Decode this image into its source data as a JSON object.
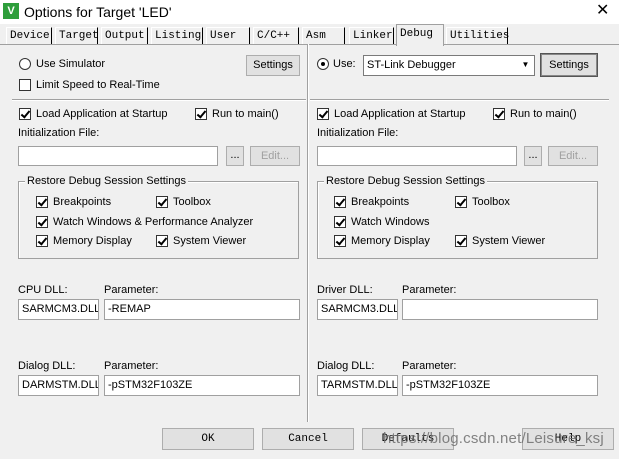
{
  "window": {
    "title": "Options for Target 'LED'",
    "icon": "V",
    "close": "✕"
  },
  "tabs": [
    "Device",
    "Target",
    "Output",
    "Listing",
    "User",
    "C/C++",
    "Asm",
    "Linker",
    "Debug",
    "Utilities"
  ],
  "active_tab": "Debug",
  "left": {
    "use_simulator": "Use Simulator",
    "settings": "Settings",
    "limit_speed": "Limit Speed to Real-Time",
    "load_app": "Load Application at Startup",
    "run_to_main": "Run to main()",
    "init_file_label": "Initialization File:",
    "init_file_value": "",
    "browse": "...",
    "edit": "Edit...",
    "restore_title": "Restore Debug Session Settings",
    "breakpoints": "Breakpoints",
    "toolbox": "Toolbox",
    "watch_windows": "Watch Windows & Performance Analyzer",
    "memory_display": "Memory Display",
    "system_viewer": "System Viewer",
    "cpu_dll_label": "CPU DLL:",
    "cpu_param_label": "Parameter:",
    "cpu_dll": "SARMCM3.DLL",
    "cpu_param": "-REMAP",
    "dialog_dll_label": "Dialog DLL:",
    "dialog_param_label": "Parameter:",
    "dialog_dll": "DARMSTM.DLL",
    "dialog_param": "-pSTM32F103ZE"
  },
  "right": {
    "use": "Use:",
    "debugger": "ST-Link Debugger",
    "settings": "Settings",
    "load_app": "Load Application at Startup",
    "run_to_main": "Run to main()",
    "init_file_label": "Initialization File:",
    "init_file_value": "",
    "browse": "...",
    "edit": "Edit...",
    "restore_title": "Restore Debug Session Settings",
    "breakpoints": "Breakpoints",
    "toolbox": "Toolbox",
    "watch_windows": "Watch Windows",
    "memory_display": "Memory Display",
    "system_viewer": "System Viewer",
    "driver_dll_label": "Driver DLL:",
    "driver_param_label": "Parameter:",
    "driver_dll": "SARMCM3.DLL",
    "driver_param": "",
    "dialog_dll_label": "Dialog DLL:",
    "dialog_param_label": "Parameter:",
    "dialog_dll": "TARMSTM.DLL",
    "dialog_param": "-pSTM32F103ZE"
  },
  "footer": {
    "ok": "OK",
    "cancel": "Cancel",
    "defaults": "Defaults",
    "help": "Help"
  },
  "watermark": "https://blog.csdn.net/Leisure_ksj",
  "colors": {
    "panel": "#f0f0f0",
    "border": "#a0a0a0",
    "icon_green": "#2e9e3b"
  }
}
